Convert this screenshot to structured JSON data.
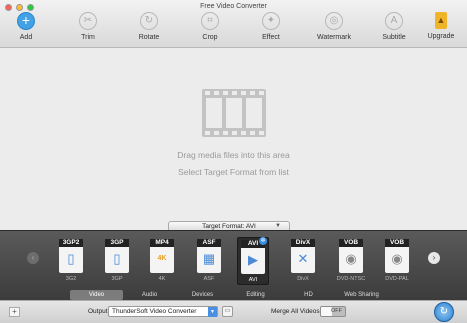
{
  "window": {
    "title": "Free Video Converter"
  },
  "toolbar": {
    "items": [
      {
        "label": "Add",
        "icon": "add-icon"
      },
      {
        "label": "Trim",
        "icon": "trim-icon"
      },
      {
        "label": "Rotate",
        "icon": "rotate-icon"
      },
      {
        "label": "Crop",
        "icon": "crop-icon"
      },
      {
        "label": "Effect",
        "icon": "effect-icon"
      },
      {
        "label": "Watermark",
        "icon": "watermark-icon"
      },
      {
        "label": "Subtitle",
        "icon": "subtitle-icon"
      },
      {
        "label": "Upgrade",
        "icon": "upgrade-icon"
      }
    ]
  },
  "drop_area": {
    "line1": "Drag media files into this area",
    "line2": "Select Target Format from list"
  },
  "target_format": {
    "label": "Target Format: AVI"
  },
  "formats": [
    {
      "tag": "3GP2",
      "name": "3G2"
    },
    {
      "tag": "3GP",
      "name": "3GP"
    },
    {
      "tag": "MP4",
      "name": "4K",
      "badge": "4K"
    },
    {
      "tag": "ASF",
      "name": "ASF"
    },
    {
      "tag": "AVI",
      "name": "AVI",
      "selected": true
    },
    {
      "tag": "DivX",
      "name": "DivX"
    },
    {
      "tag": "VOB",
      "name": "DVD-NTSC"
    },
    {
      "tag": "VOB",
      "name": "DVD-PAL"
    }
  ],
  "categories": [
    "Video",
    "Audio",
    "Devices",
    "Editing",
    "HD",
    "Web Sharing"
  ],
  "active_category": "Video",
  "output": {
    "label": "Output:",
    "value": "ThunderSoft Video Converter"
  },
  "merge": {
    "label": "Merge All Videos:",
    "state": "OFF"
  },
  "colors": {
    "accent": "#3a8ee6",
    "panel": "#4a4a4a"
  }
}
